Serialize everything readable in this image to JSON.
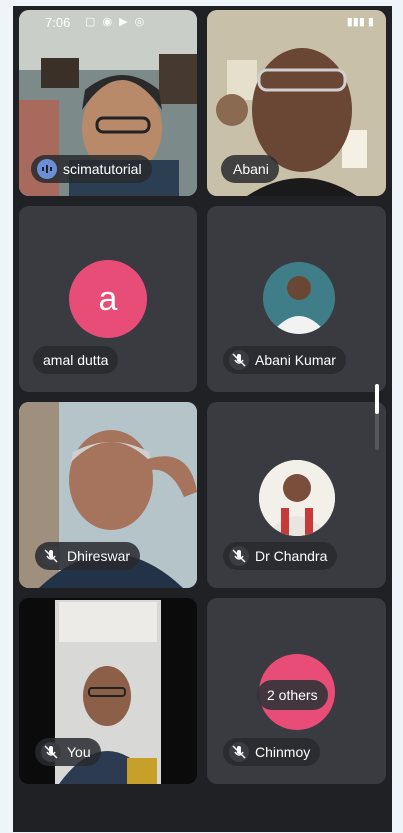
{
  "status_bar": {
    "time": "7:06"
  },
  "participants": [
    {
      "name": "scimatutorial"
    },
    {
      "name": "Abani"
    },
    {
      "name": "amal dutta",
      "initial": "a",
      "avatar_color": "#e84d78"
    },
    {
      "name": "Abani Kumar"
    },
    {
      "name": "Dhireswar"
    },
    {
      "name": "Dr Chandra"
    },
    {
      "name": "You"
    },
    {
      "name": "Chinmoy",
      "others_label": "2 others"
    }
  ],
  "colors": {
    "tile_bg": "#3b3e44",
    "screen_bg": "#1f2125",
    "avatar_pink": "#e84d78",
    "speaking_border": "#6b8fd6"
  }
}
